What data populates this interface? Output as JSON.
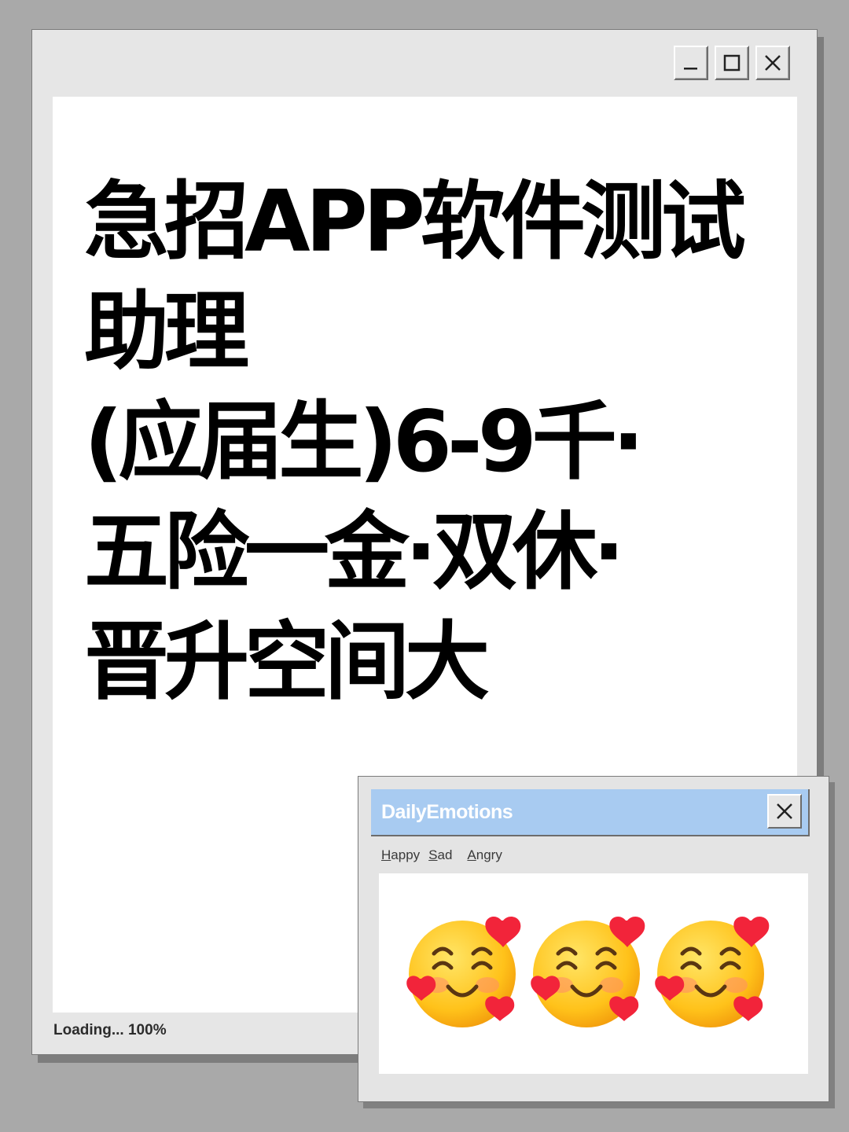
{
  "main_window": {
    "controls": {
      "minimize": "minimize-icon",
      "maximize": "maximize-icon",
      "close": "close-icon"
    },
    "headline_lines": [
      "急招APP软件测试",
      "助理",
      "(应届生)6-9千·",
      "五险一金·双休·",
      "晋升空间大"
    ],
    "status_text": "Loading... 100%"
  },
  "popup": {
    "title": "DailyEmotions",
    "title_bar_color": "#a8cbf1",
    "close_icon": "close-icon",
    "menu": [
      {
        "mnemonic": "H",
        "rest": "appy"
      },
      {
        "mnemonic": "S",
        "rest": "ad"
      },
      {
        "mnemonic": "A",
        "rest": "ngry"
      }
    ],
    "emojis": [
      "smiling-face-with-hearts",
      "smiling-face-with-hearts",
      "smiling-face-with-hearts"
    ]
  }
}
